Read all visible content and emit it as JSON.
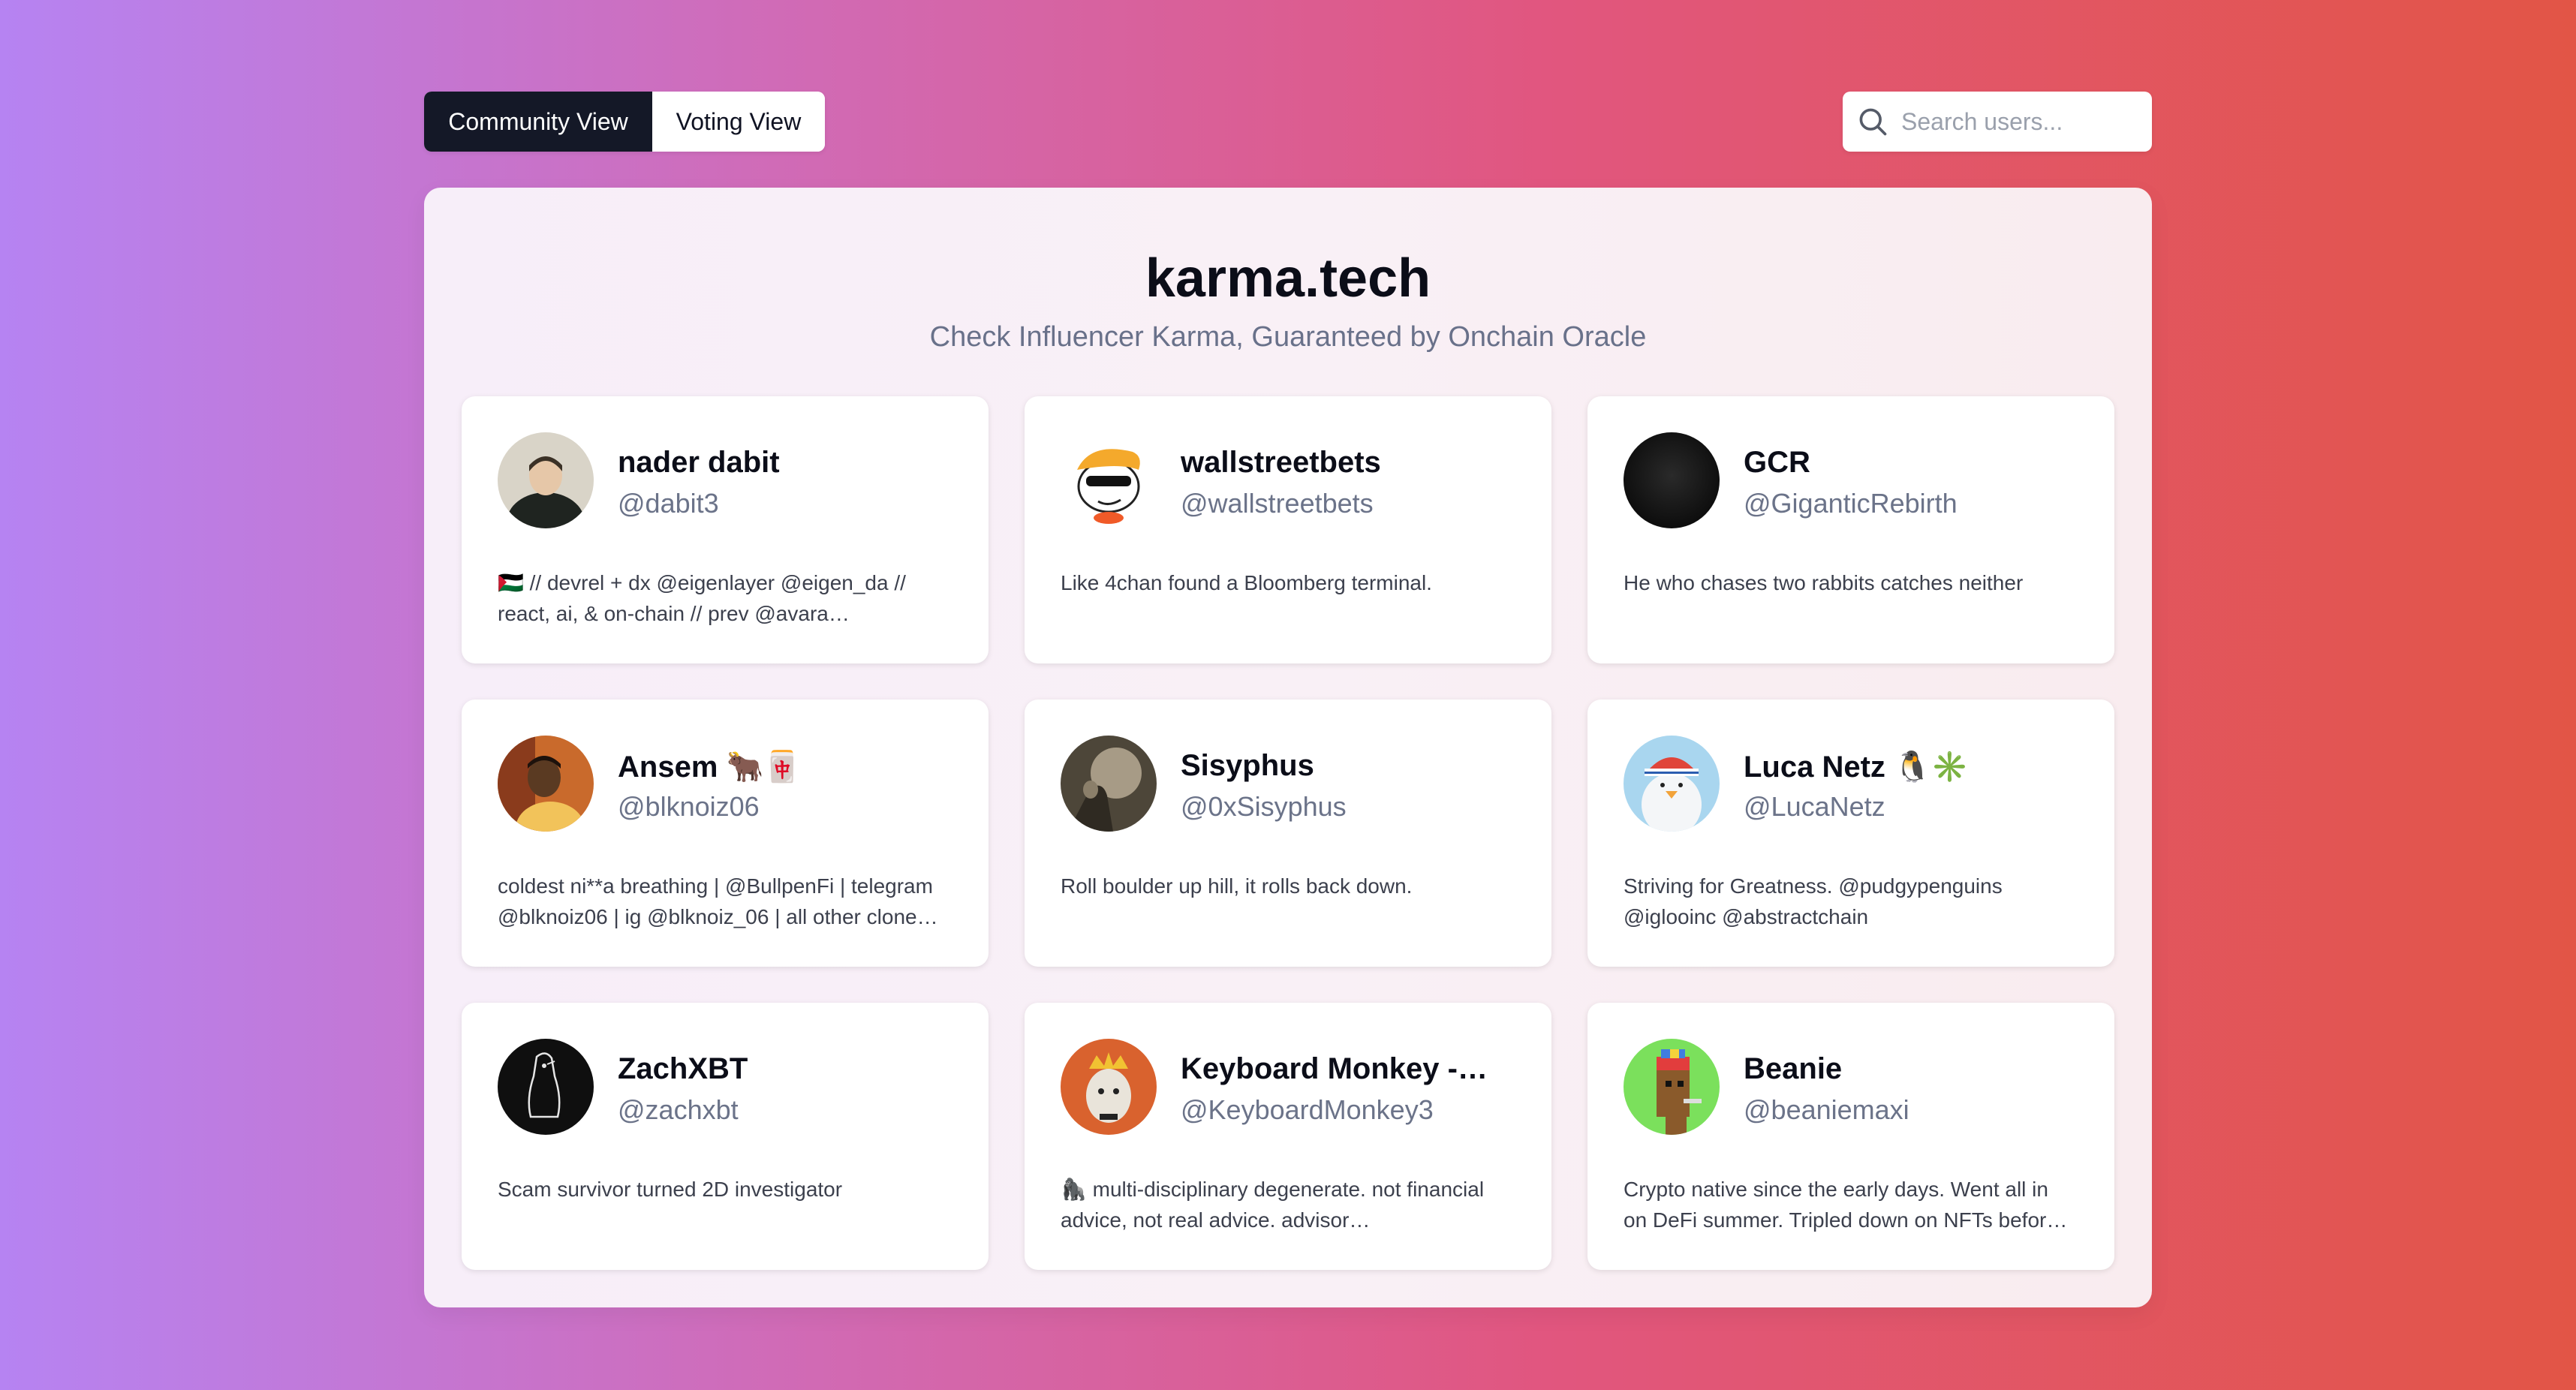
{
  "tabs": {
    "community": "Community View",
    "voting": "Voting View"
  },
  "search": {
    "placeholder": "Search users..."
  },
  "header": {
    "title": "karma.tech",
    "subtitle": "Check Influencer Karma, Guaranteed by Onchain Oracle"
  },
  "cards": [
    {
      "name": "nader dabit",
      "handle": "@dabit3",
      "bio": "🇵🇸 // devrel + dx @eigenlayer @eigen_da // react, ai, & on-chain // prev @avara…"
    },
    {
      "name": "wallstreetbets",
      "handle": "@wallstreetbets",
      "bio": "Like 4chan found a Bloomberg terminal."
    },
    {
      "name": "GCR",
      "handle": "@GiganticRebirth",
      "bio": "He who chases two rabbits catches neither"
    },
    {
      "name": "Ansem 🐂🀄",
      "handle": "@blknoiz06",
      "bio": "coldest ni**a breathing | @BullpenFi | telegram @blknoiz06 | ig @blknoiz_06 | all other clone…"
    },
    {
      "name": "Sisyphus",
      "handle": "@0xSisyphus",
      "bio": "Roll boulder up hill, it rolls back down."
    },
    {
      "name": "Luca Netz 🐧✳️",
      "handle": "@LucaNetz",
      "bio": "Striving for Greatness. @pudgypenguins @iglooinc @abstractchain"
    },
    {
      "name": "ZachXBT",
      "handle": "@zachxbt",
      "bio": "Scam survivor turned 2D investigator"
    },
    {
      "name": "Keyboard Monkey -…",
      "handle": "@KeyboardMonkey3",
      "bio": "🦍 multi-disciplinary degenerate. not financial advice, not real advice. advisor…"
    },
    {
      "name": "Beanie",
      "handle": "@beaniemaxi",
      "bio": "Crypto native since the early days. Went all in on DeFi summer. Tripled down on NFTs befor…"
    }
  ],
  "icons": {
    "search": "search-icon"
  },
  "colors": {
    "active_tab": "#141827",
    "title": "#0b0d18",
    "muted": "#6b7389"
  }
}
